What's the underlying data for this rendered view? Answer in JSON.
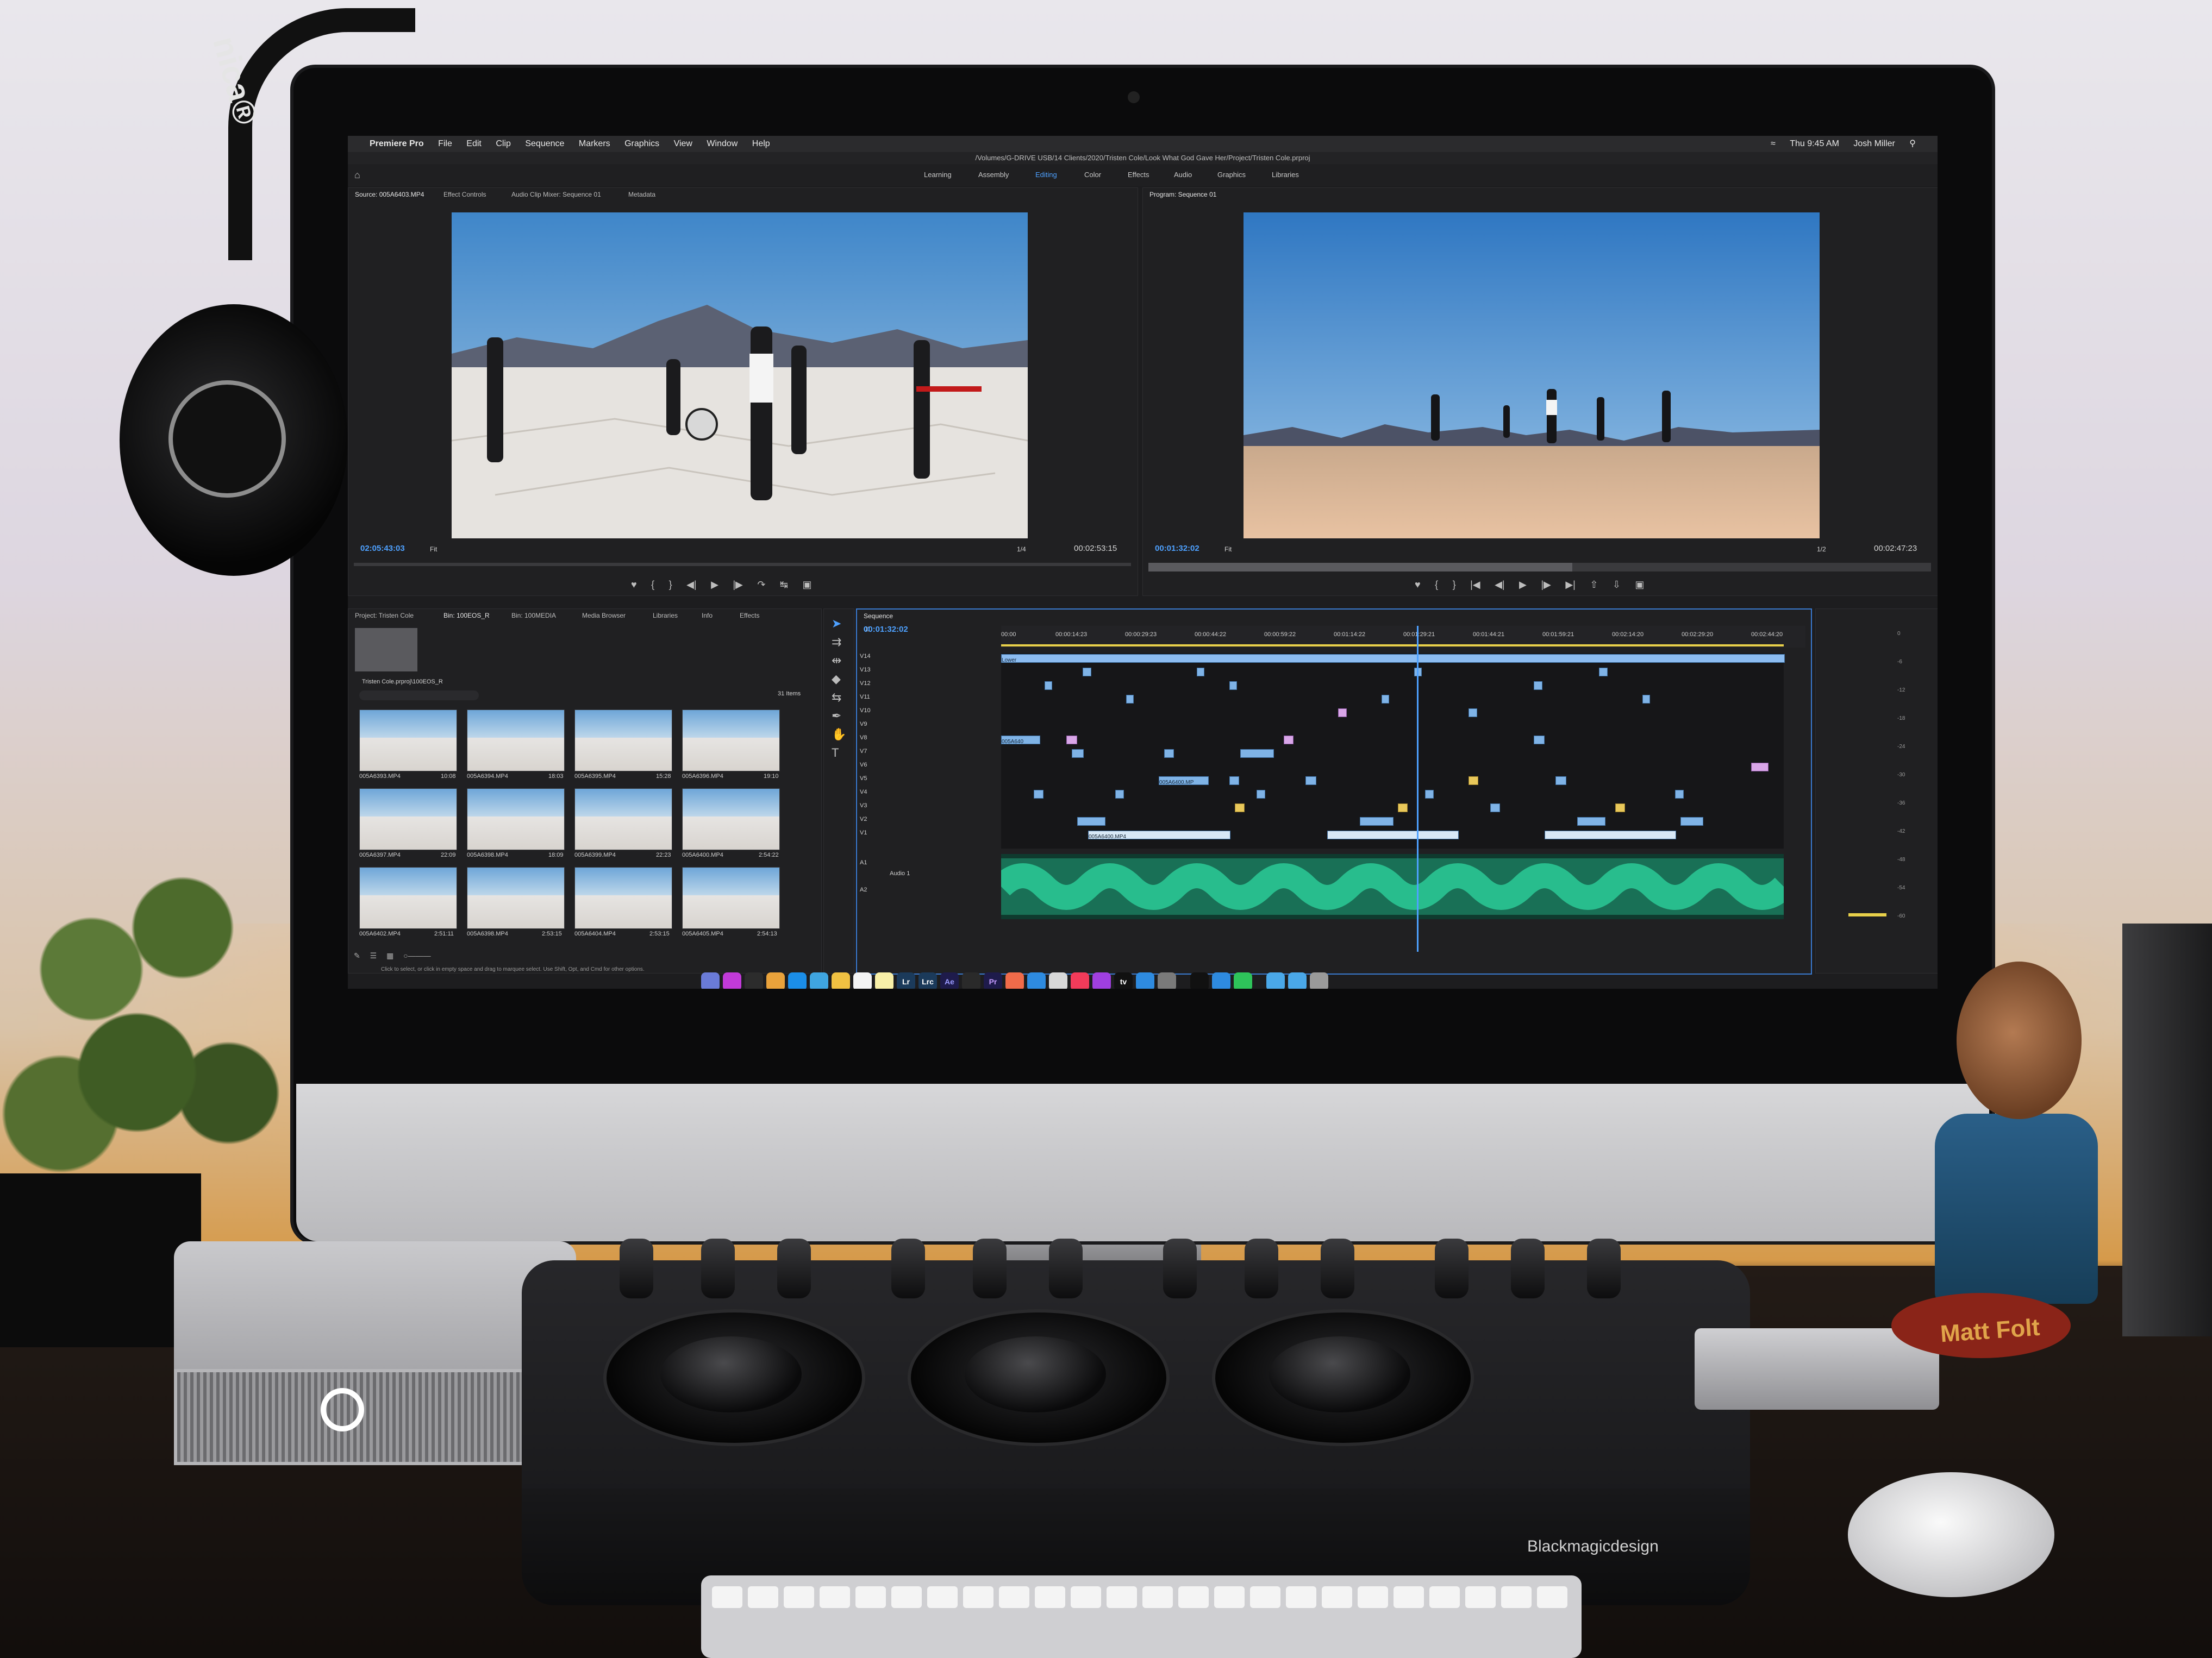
{
  "menubar": {
    "app_name": "Premiere Pro",
    "items": [
      "File",
      "Edit",
      "Clip",
      "Sequence",
      "Markers",
      "Graphics",
      "View",
      "Window",
      "Help"
    ],
    "clock": "Thu 9:45 AM",
    "user": "Josh Miller"
  },
  "window_title": "/Volumes/G-DRIVE USB/14 Clients/2020/Tristen Cole/Look What God Gave Her/Project/Tristen Cole.prproj",
  "workspaces": {
    "items": [
      "Learning",
      "Assembly",
      "Editing",
      "Color",
      "Effects",
      "Audio",
      "Graphics",
      "Libraries"
    ],
    "active": "Editing"
  },
  "source_monitor": {
    "tabs": [
      "Source: 005A6403.MP4",
      "Effect Controls",
      "Audio Clip Mixer: Sequence 01",
      "Metadata"
    ],
    "timecode": "02:05:43:03",
    "fit": "Fit",
    "scale": "1/4",
    "duration": "00:02:53:15"
  },
  "program_monitor": {
    "tab": "Program: Sequence 01",
    "timecode": "00:01:32:02",
    "fit": "Fit",
    "scale": "1/2",
    "duration": "00:02:47:23"
  },
  "project_panel": {
    "tabs": [
      "Project: Tristen Cole",
      "Bin: 100EOS_R",
      "Bin: 100MEDIA",
      "Media Browser",
      "Libraries",
      "Info",
      "Effects"
    ],
    "path": "Tristen Cole.prproj\\100EOS_R",
    "item_count": "31 Items",
    "clips": [
      {
        "name": "005A6393.MP4",
        "duration": "10:08"
      },
      {
        "name": "005A6394.MP4",
        "duration": "18:03"
      },
      {
        "name": "005A6395.MP4",
        "duration": "15:28"
      },
      {
        "name": "005A6396.MP4",
        "duration": "19:10"
      },
      {
        "name": "005A6397.MP4",
        "duration": "22:09"
      },
      {
        "name": "005A6398.MP4",
        "duration": "18:09"
      },
      {
        "name": "005A6399.MP4",
        "duration": "22:23"
      },
      {
        "name": "005A6400.MP4",
        "duration": "2:54:22"
      },
      {
        "name": "005A6402.MP4",
        "duration": "2:51:11"
      },
      {
        "name": "005A6398.MP4",
        "duration": "2:53:15"
      },
      {
        "name": "005A6404.MP4",
        "duration": "2:53:15"
      },
      {
        "name": "005A6405.MP4",
        "duration": "2:54:13"
      }
    ],
    "status_hint": "Click to select, or click in empty space and drag to marquee select. Use Shift, Opt, and Cmd for other options."
  },
  "timeline": {
    "tab": "Sequence 01",
    "timecode": "00:01:32:02",
    "ruler": [
      "00:00",
      "00:00:14:23",
      "00:00:29:23",
      "00:00:44:22",
      "00:00:59:22",
      "00:01:14:22",
      "00:01:29:21",
      "00:01:44:21",
      "00:01:59:21",
      "00:02:14:20",
      "00:02:29:20",
      "00:02:44:20"
    ],
    "video_tracks": [
      "V14",
      "V13",
      "V12",
      "V11",
      "V10",
      "V9",
      "V8",
      "V7",
      "V6",
      "V5",
      "V4",
      "V3",
      "V2",
      "V1"
    ],
    "audio_tracks": [
      "A1",
      "A2"
    ],
    "audio_label": "Audio 1",
    "top_clip_label": "Lower",
    "clip_labels": [
      "005A6400.MP4",
      "005A640",
      "005A6400.MP"
    ]
  },
  "meter_scale": [
    "0",
    "-6",
    "-12",
    "-18",
    "-24",
    "-30",
    "-36",
    "-42",
    "-48",
    "-54",
    "-60"
  ],
  "dock_apps": [
    "Lr",
    "Lrc",
    "Ae",
    "Pr",
    "tv"
  ],
  "headphones_brand": "nica®",
  "controller_brand": "Blackmagicdesign",
  "bobblehead_name": "Matt Folt",
  "colors": {
    "accent_blue": "#4ea1ff",
    "audio_green": "#2ed8a0",
    "clip_blue": "#7fb3e6",
    "clip_pink": "#d9a6e8",
    "clip_yellow": "#e9c85a"
  }
}
